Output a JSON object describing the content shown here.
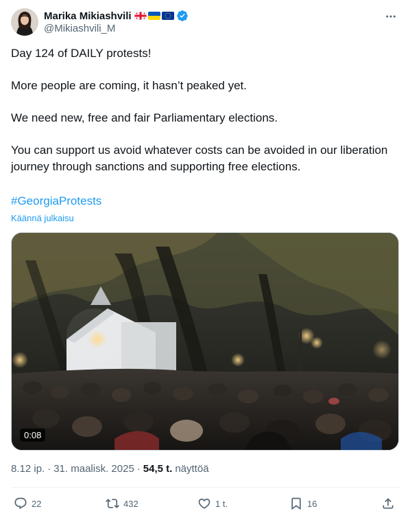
{
  "author": {
    "display_name": "Marika Mikiashvili",
    "handle": "@Mikiashvili_M",
    "flags": [
      "georgia-flag",
      "ukraine-flag",
      "eu-flag"
    ],
    "verified": true
  },
  "tweet": {
    "paragraphs": [
      "Day 124 of DAILY protests!",
      "More people are coming, it hasn’t peaked yet.",
      "We need new, free and fair Parliamentary elections.",
      "You can support us avoid whatever costs can be avoided in our liberation journey through sanctions and supporting free elections."
    ],
    "hashtag": "#GeorgiaProtests",
    "translate_label": "Käännä julkaisu"
  },
  "media": {
    "type": "video",
    "duration": "0:08"
  },
  "meta": {
    "time": "8.12 ip.",
    "date": "31. maalisk. 2025",
    "views_count": "54,5 t.",
    "views_label": "näyttöä"
  },
  "actions": {
    "reply_count": "22",
    "retweet_count": "432",
    "like_count": "1 t.",
    "bookmark_count": "16"
  },
  "colors": {
    "accent": "#1d9bf0",
    "text": "#0f1419",
    "secondary": "#536471"
  }
}
